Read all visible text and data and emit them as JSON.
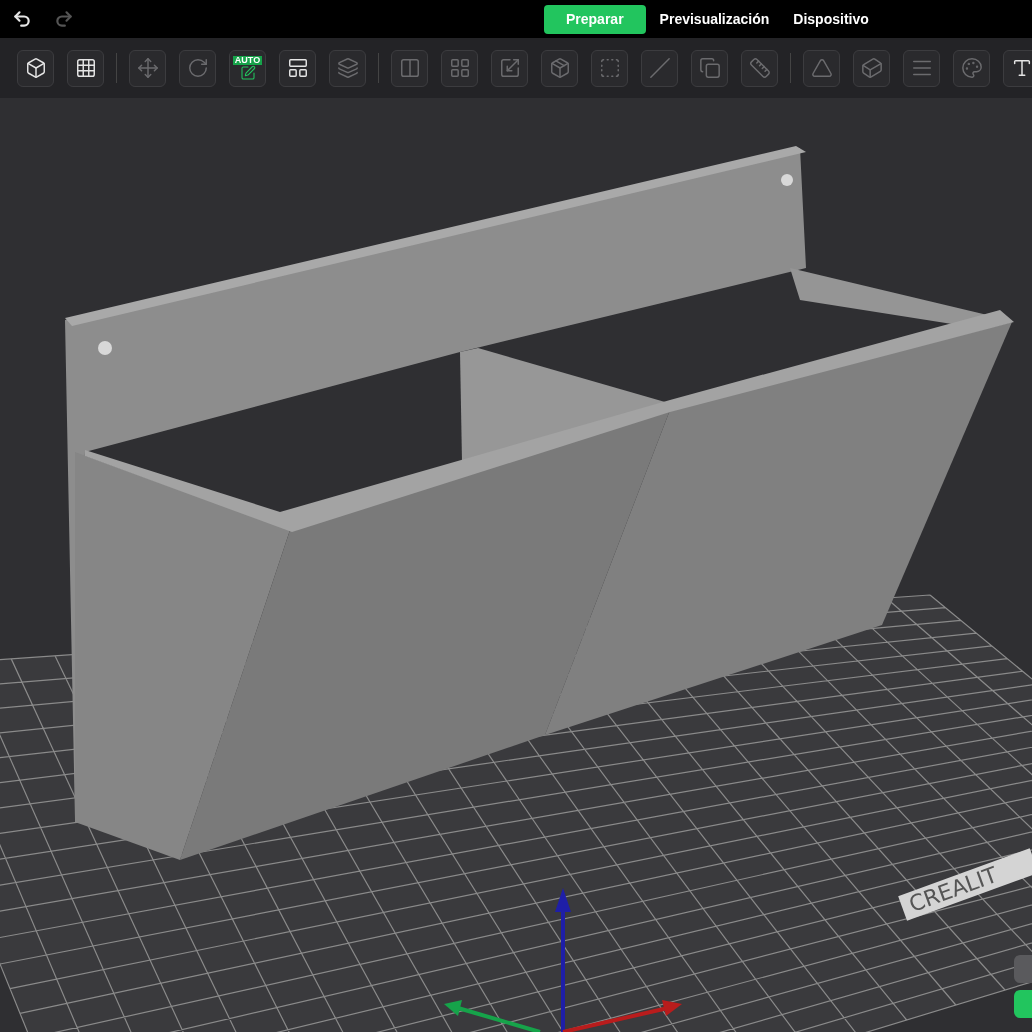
{
  "title_bar": {
    "undo": {
      "disabled": false
    },
    "redo": {
      "disabled": true
    },
    "tabs": [
      {
        "label": "Preparar",
        "selected": true
      },
      {
        "label": "Previsualización",
        "selected": false
      },
      {
        "label": "Dispositivo",
        "selected": false
      }
    ]
  },
  "toolbar": {
    "groups": [
      [
        {
          "disabled": false
        },
        {
          "disabled": false
        }
      ],
      [
        {
          "disabled": true
        },
        {
          "disabled": true
        },
        {
          "disabled": false,
          "badge": "AUTO"
        },
        {
          "disabled": false
        },
        {
          "disabled": true
        }
      ],
      [
        {
          "disabled": true
        },
        {
          "disabled": true
        },
        {
          "disabled": true
        },
        {
          "disabled": true
        },
        {
          "disabled": true
        },
        {
          "disabled": true
        },
        {
          "disabled": true
        },
        {
          "disabled": true
        }
      ],
      [
        {
          "disabled": true
        },
        {
          "disabled": true
        },
        {
          "disabled": true
        },
        {
          "disabled": true
        },
        {
          "disabled": false
        }
      ]
    ]
  },
  "viewport": {
    "bed_logo": "CREALIT"
  }
}
